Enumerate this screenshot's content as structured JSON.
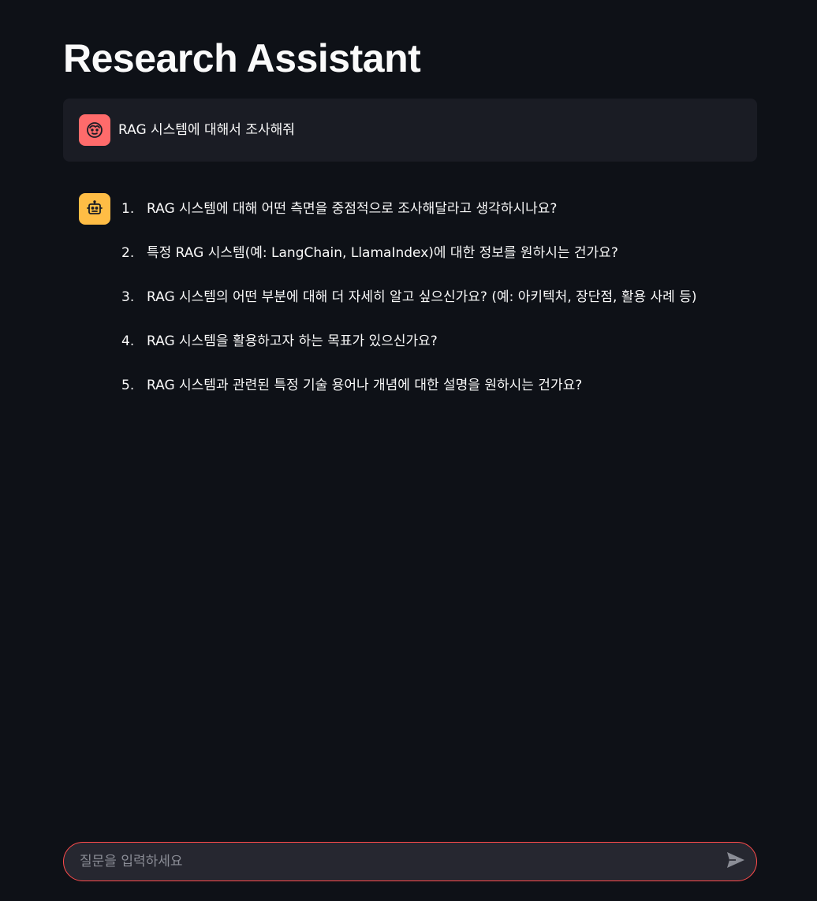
{
  "app": {
    "title": "Research Assistant"
  },
  "messages": {
    "user": {
      "avatar_icon": "user-face-icon",
      "avatar_color": "#ff6b6b",
      "text": "RAG 시스템에 대해서 조사해줘"
    },
    "assistant": {
      "avatar_icon": "robot-icon",
      "avatar_color": "#ffbd45",
      "items": [
        {
          "num": "1.",
          "text": "RAG 시스템에 대해 어떤 측면을 중점적으로 조사해달라고 생각하시나요?"
        },
        {
          "num": "2.",
          "text": "특정 RAG 시스템(예: LangChain, LlamaIndex)에 대한 정보를 원하시는 건가요?"
        },
        {
          "num": "3.",
          "text": "RAG 시스템의 어떤 부분에 대해 더 자세히 알고 싶으신가요? (예: 아키텍처, 장단점, 활용 사례 등)"
        },
        {
          "num": "4.",
          "text": "RAG 시스템을 활용하고자 하는 목표가 있으신가요?"
        },
        {
          "num": "5.",
          "text": "RAG 시스템과 관련된 특정 기술 용어나 개념에 대한 설명을 원하시는 건가요?"
        }
      ]
    }
  },
  "chat_input": {
    "placeholder": "질문을 입력하세요",
    "value": "",
    "send_icon": "send-icon",
    "border_color": "#ff4b4b"
  }
}
